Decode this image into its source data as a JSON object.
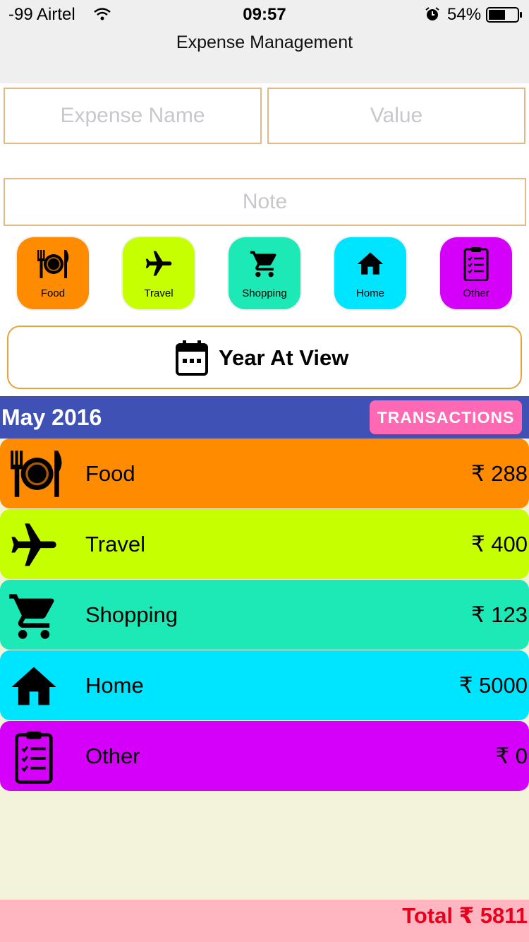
{
  "status": {
    "carrier": "-99 Airtel",
    "time": "09:57",
    "battery": "54%"
  },
  "nav": {
    "title": "Expense Management"
  },
  "form": {
    "expense_name_placeholder": "Expense Name",
    "value_placeholder": "Value",
    "note_placeholder": "Note"
  },
  "categories": [
    {
      "label": "Food",
      "icon": "food-icon",
      "color": "#ff8c00"
    },
    {
      "label": "Travel",
      "icon": "airplane-icon",
      "color": "#c6ff00"
    },
    {
      "label": "Shopping",
      "icon": "cart-icon",
      "color": "#1de9b6"
    },
    {
      "label": "Home",
      "icon": "home-icon",
      "color": "#00e5ff"
    },
    {
      "label": "Other",
      "icon": "clipboard-icon",
      "color": "#d500f9"
    }
  ],
  "year_button": {
    "label": "Year At View",
    "icon": "calendar-icon"
  },
  "month": {
    "label": "May 2016",
    "transactions_label": "TRANSACTIONS"
  },
  "expenses": [
    {
      "name": "Food",
      "amount": "₹ 288",
      "icon": "food-icon",
      "color": "#ff8c00"
    },
    {
      "name": "Travel",
      "amount": "₹ 400",
      "icon": "airplane-icon",
      "color": "#c6ff00"
    },
    {
      "name": "Shopping",
      "amount": "₹ 123",
      "icon": "cart-icon",
      "color": "#1de9b6"
    },
    {
      "name": "Home",
      "amount": "₹ 5000",
      "icon": "home-icon",
      "color": "#00e5ff"
    },
    {
      "name": "Other",
      "amount": "₹ 0",
      "icon": "clipboard-icon",
      "color": "#d500f9"
    }
  ],
  "footer": {
    "total": "Total ₹ 5811"
  },
  "colors": {
    "accent_header": "#3f51b5",
    "transactions_button": "#ff69b4",
    "list_background": "#f3f3dc",
    "footer_background": "#ffb6c1",
    "total_text": "#e8001c",
    "input_border": "#e3b988"
  }
}
